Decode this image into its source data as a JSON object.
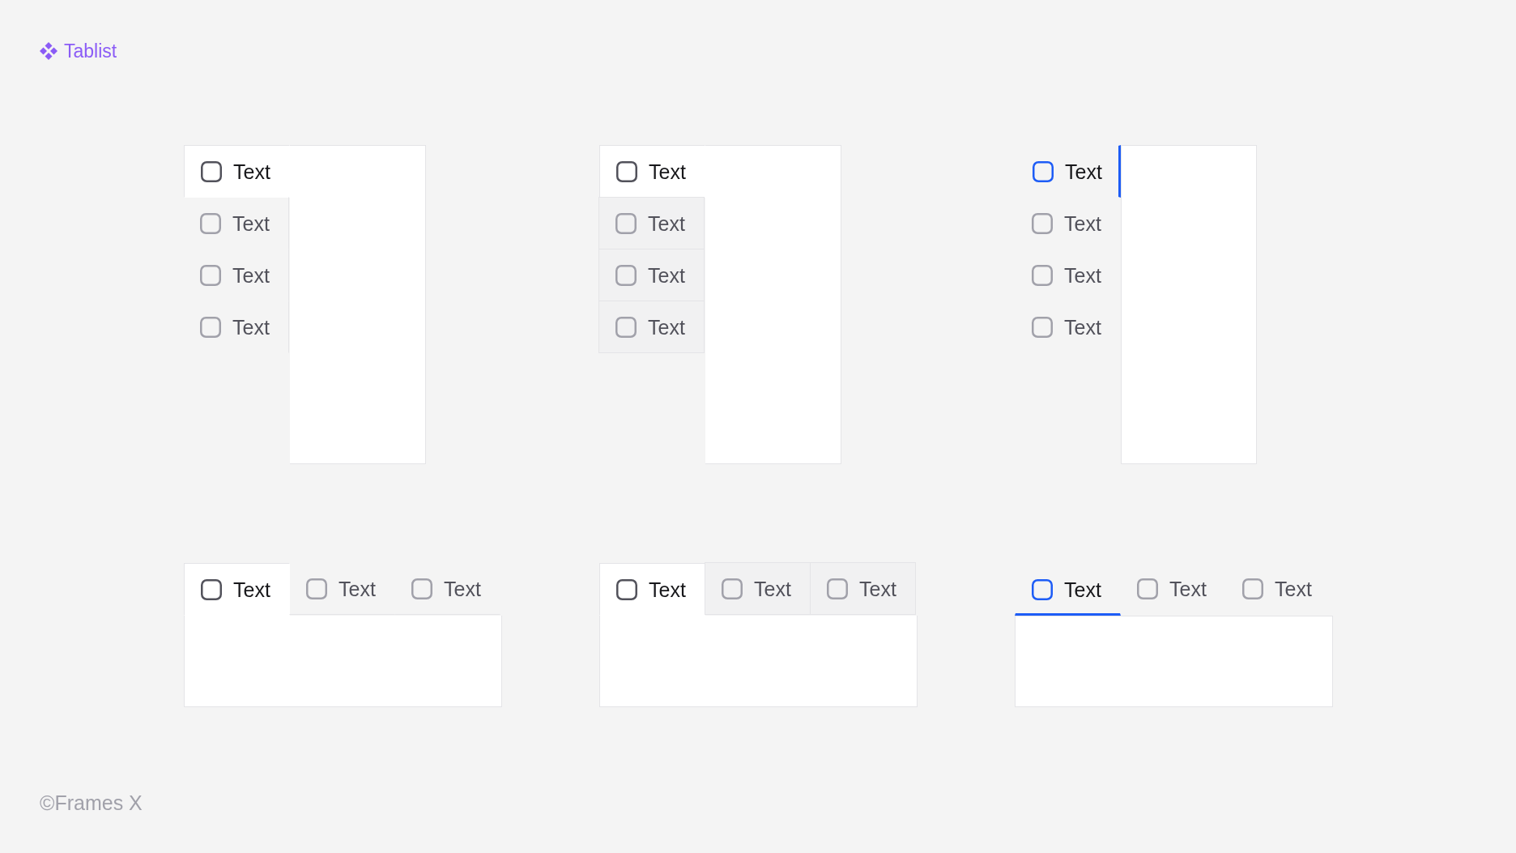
{
  "header": {
    "title": "Tablist"
  },
  "tablists": [
    {
      "vertical": true,
      "kind": "plain",
      "tabs": [
        {
          "label": "Text",
          "selected": true
        },
        {
          "label": "Text",
          "selected": false
        },
        {
          "label": "Text",
          "selected": false
        },
        {
          "label": "Text",
          "selected": false
        }
      ]
    },
    {
      "vertical": true,
      "kind": "boxed",
      "tabs": [
        {
          "label": "Text",
          "selected": true
        },
        {
          "label": "Text",
          "selected": false
        },
        {
          "label": "Text",
          "selected": false
        },
        {
          "label": "Text",
          "selected": false
        }
      ]
    },
    {
      "vertical": true,
      "kind": "underline",
      "tabs": [
        {
          "label": "Text",
          "selected": true
        },
        {
          "label": "Text",
          "selected": false
        },
        {
          "label": "Text",
          "selected": false
        },
        {
          "label": "Text",
          "selected": false
        }
      ]
    },
    {
      "vertical": false,
      "kind": "plain",
      "tabs": [
        {
          "label": "Text",
          "selected": true
        },
        {
          "label": "Text",
          "selected": false
        },
        {
          "label": "Text",
          "selected": false
        }
      ]
    },
    {
      "vertical": false,
      "kind": "boxed",
      "tabs": [
        {
          "label": "Text",
          "selected": true
        },
        {
          "label": "Text",
          "selected": false
        },
        {
          "label": "Text",
          "selected": false
        }
      ]
    },
    {
      "vertical": false,
      "kind": "underline",
      "tabs": [
        {
          "label": "Text",
          "selected": true
        },
        {
          "label": "Text",
          "selected": false
        },
        {
          "label": "Text",
          "selected": false
        }
      ]
    }
  ],
  "footer": {
    "copyright": "©Frames X"
  }
}
